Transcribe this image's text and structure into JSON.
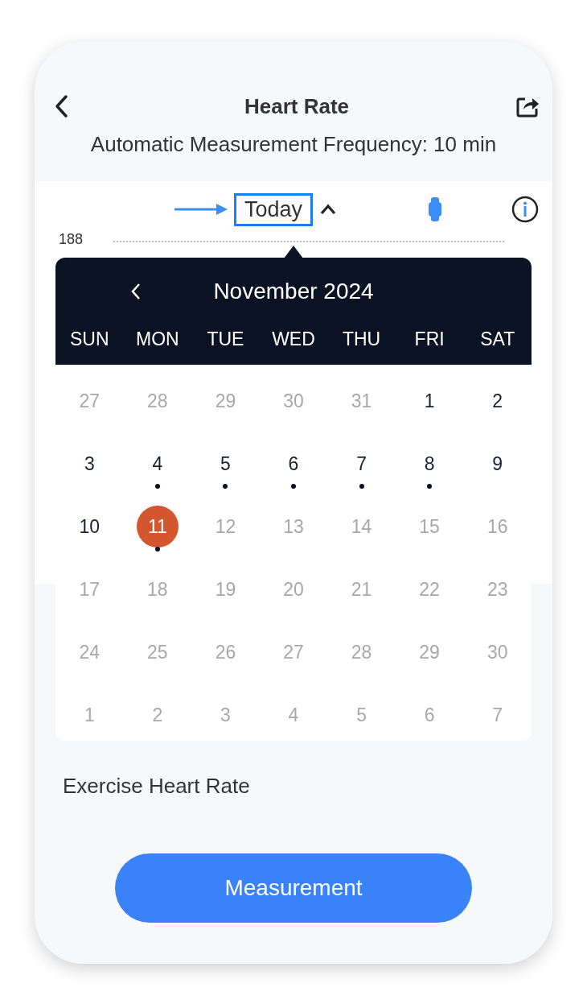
{
  "header": {
    "title": "Heart Rate"
  },
  "subtitle": "Automatic Measurement Frequency: 10 min",
  "chart_toolbar": {
    "date_label": "Today",
    "highlighted": true,
    "expanded": true
  },
  "chart": {
    "axis_max": "188"
  },
  "calendar": {
    "title": "November 2024",
    "weekdays": [
      "SUN",
      "MON",
      "TUE",
      "WED",
      "THU",
      "FRI",
      "SAT"
    ],
    "days": [
      {
        "day": "27",
        "muted": true,
        "has_data": false,
        "selected": false
      },
      {
        "day": "28",
        "muted": true,
        "has_data": false,
        "selected": false
      },
      {
        "day": "29",
        "muted": true,
        "has_data": false,
        "selected": false
      },
      {
        "day": "30",
        "muted": true,
        "has_data": false,
        "selected": false
      },
      {
        "day": "31",
        "muted": true,
        "has_data": false,
        "selected": false
      },
      {
        "day": "1",
        "muted": false,
        "has_data": false,
        "selected": false
      },
      {
        "day": "2",
        "muted": false,
        "has_data": false,
        "selected": false
      },
      {
        "day": "3",
        "muted": false,
        "has_data": false,
        "selected": false
      },
      {
        "day": "4",
        "muted": false,
        "has_data": true,
        "selected": false
      },
      {
        "day": "5",
        "muted": false,
        "has_data": true,
        "selected": false
      },
      {
        "day": "6",
        "muted": false,
        "has_data": true,
        "selected": false
      },
      {
        "day": "7",
        "muted": false,
        "has_data": true,
        "selected": false
      },
      {
        "day": "8",
        "muted": false,
        "has_data": true,
        "selected": false
      },
      {
        "day": "9",
        "muted": false,
        "has_data": false,
        "selected": false
      },
      {
        "day": "10",
        "muted": false,
        "has_data": false,
        "selected": false
      },
      {
        "day": "11",
        "muted": false,
        "has_data": true,
        "selected": true
      },
      {
        "day": "12",
        "muted": true,
        "has_data": false,
        "selected": false
      },
      {
        "day": "13",
        "muted": true,
        "has_data": false,
        "selected": false
      },
      {
        "day": "14",
        "muted": true,
        "has_data": false,
        "selected": false
      },
      {
        "day": "15",
        "muted": true,
        "has_data": false,
        "selected": false
      },
      {
        "day": "16",
        "muted": true,
        "has_data": false,
        "selected": false
      },
      {
        "day": "17",
        "muted": true,
        "has_data": false,
        "selected": false
      },
      {
        "day": "18",
        "muted": true,
        "has_data": false,
        "selected": false
      },
      {
        "day": "19",
        "muted": true,
        "has_data": false,
        "selected": false
      },
      {
        "day": "20",
        "muted": true,
        "has_data": false,
        "selected": false
      },
      {
        "day": "21",
        "muted": true,
        "has_data": false,
        "selected": false
      },
      {
        "day": "22",
        "muted": true,
        "has_data": false,
        "selected": false
      },
      {
        "day": "23",
        "muted": true,
        "has_data": false,
        "selected": false
      },
      {
        "day": "24",
        "muted": true,
        "has_data": false,
        "selected": false
      },
      {
        "day": "25",
        "muted": true,
        "has_data": false,
        "selected": false
      },
      {
        "day": "26",
        "muted": true,
        "has_data": false,
        "selected": false
      },
      {
        "day": "27",
        "muted": true,
        "has_data": false,
        "selected": false
      },
      {
        "day": "28",
        "muted": true,
        "has_data": false,
        "selected": false
      },
      {
        "day": "29",
        "muted": true,
        "has_data": false,
        "selected": false
      },
      {
        "day": "30",
        "muted": true,
        "has_data": false,
        "selected": false
      },
      {
        "day": "1",
        "muted": true,
        "has_data": false,
        "selected": false
      },
      {
        "day": "2",
        "muted": true,
        "has_data": false,
        "selected": false
      },
      {
        "day": "3",
        "muted": true,
        "has_data": false,
        "selected": false
      },
      {
        "day": "4",
        "muted": true,
        "has_data": false,
        "selected": false
      },
      {
        "day": "5",
        "muted": true,
        "has_data": false,
        "selected": false
      },
      {
        "day": "6",
        "muted": true,
        "has_data": false,
        "selected": false
      },
      {
        "day": "7",
        "muted": true,
        "has_data": false,
        "selected": false
      }
    ]
  },
  "section_title": "Exercise Heart Rate",
  "measure_button": "Measurement"
}
